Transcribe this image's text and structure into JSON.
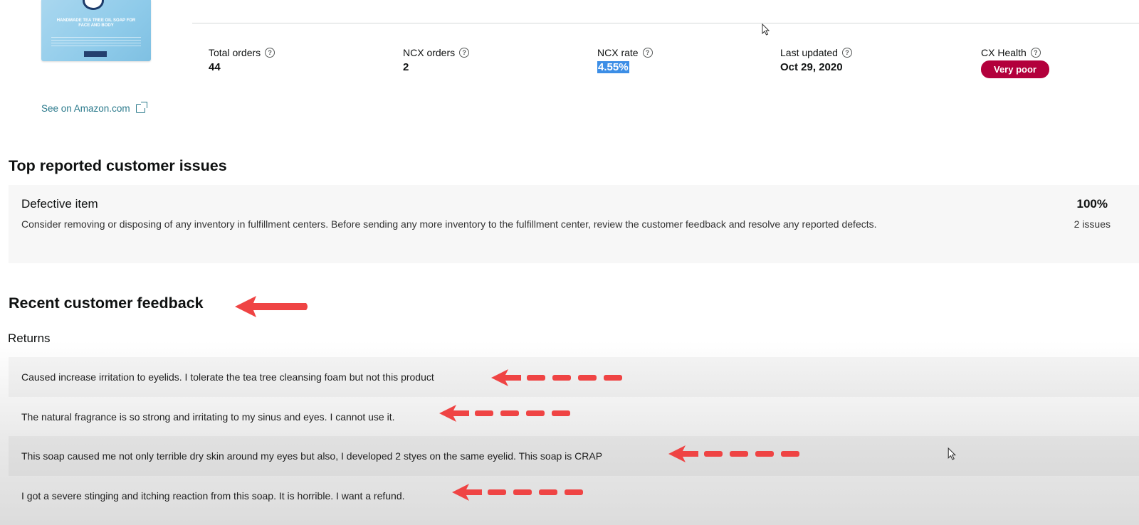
{
  "product": {
    "image_text": "HANDMADE TEA TREE OIL SOAP FOR FACE AND BODY",
    "amazon_link": "See on Amazon.com"
  },
  "metrics": [
    {
      "label": "Total orders",
      "value": "44"
    },
    {
      "label": "NCX orders",
      "value": "2"
    },
    {
      "label": "NCX rate",
      "value": "4.55%"
    },
    {
      "label": "Last updated",
      "value": "Oct 29, 2020"
    },
    {
      "label": "CX Health",
      "value": "Very poor"
    }
  ],
  "issues_section": {
    "title": "Top reported customer issues",
    "issue": {
      "name": "Defective item",
      "description": "Consider removing or disposing of any inventory in fulfillment centers. Before sending any more inventory to the fulfillment center, review the customer feedback and resolve any reported defects.",
      "percent": "100%",
      "count": "2 issues"
    }
  },
  "feedback_section": {
    "title": "Recent customer feedback",
    "subtitle": "Returns",
    "items": [
      "Caused increase irritation to eyelids. I tolerate the tea tree cleansing foam but not this product",
      "The natural fragrance is so strong and irritating to my sinus and eyes. I cannot use it.",
      "This soap caused me not only terrible dry skin around my eyes but also, I developed 2 styes on the same eyelid. This soap is CRAP",
      "I got a severe stinging and itching reaction from this soap. It is horrible. I want a refund."
    ]
  },
  "colors": {
    "badge_red": "#b3003c",
    "annotation_red": "#ef4444",
    "link_teal": "#2b7a8c",
    "highlight_blue": "#3c8ee6"
  },
  "icons": {
    "help": "question-circle-icon",
    "external": "external-link-icon",
    "cursor": "mouse-pointer-icon"
  }
}
